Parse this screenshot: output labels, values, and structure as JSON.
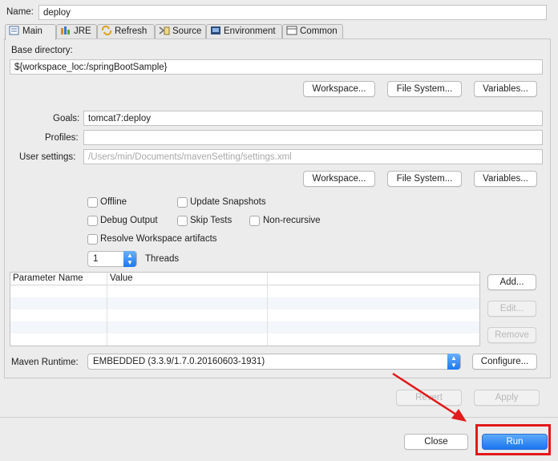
{
  "name": {
    "label": "Name:",
    "value": "deploy"
  },
  "tabs": [
    {
      "label": "Main",
      "icon": "main-tab-icon",
      "active": true
    },
    {
      "label": "JRE",
      "icon": "jre-icon"
    },
    {
      "label": "Refresh",
      "icon": "refresh-icon"
    },
    {
      "label": "Source",
      "icon": "source-icon"
    },
    {
      "label": "Environment",
      "icon": "environment-icon"
    },
    {
      "label": "Common",
      "icon": "common-icon"
    }
  ],
  "main": {
    "base_directory_label": "Base directory:",
    "base_directory_value": "${workspace_loc:/springBootSample}",
    "buttons1": {
      "workspace": "Workspace...",
      "file_system": "File System...",
      "variables": "Variables..."
    },
    "goals_label": "Goals:",
    "goals_value": "tomcat7:deploy",
    "profiles_label": "Profiles:",
    "profiles_value": "",
    "user_settings_label": "User settings:",
    "user_settings_placeholder": "/Users/min/Documents/mavenSetting/settings.xml",
    "buttons2": {
      "workspace": "Workspace...",
      "file_system": "File System...",
      "variables": "Variables..."
    },
    "options": {
      "offline": "Offline",
      "update_snapshots": "Update Snapshots",
      "debug_output": "Debug Output",
      "skip_tests": "Skip Tests",
      "non_recursive": "Non-recursive",
      "resolve_workspace": "Resolve Workspace artifacts"
    },
    "threads_value": "1",
    "threads_label": "Threads",
    "table": {
      "columns": [
        "Parameter Name",
        "Value"
      ],
      "add": "Add...",
      "edit": "Edit...",
      "remove": "Remove"
    },
    "runtime_label": "Maven Runtime:",
    "runtime_value": "EMBEDDED (3.3.9/1.7.0.20160603-1931)",
    "configure": "Configure..."
  },
  "footer": {
    "revert": "Revert",
    "apply": "Apply",
    "close": "Close",
    "run": "Run"
  },
  "colors": {
    "annotation": "#e21a1a",
    "primary": "#1a74f0"
  }
}
